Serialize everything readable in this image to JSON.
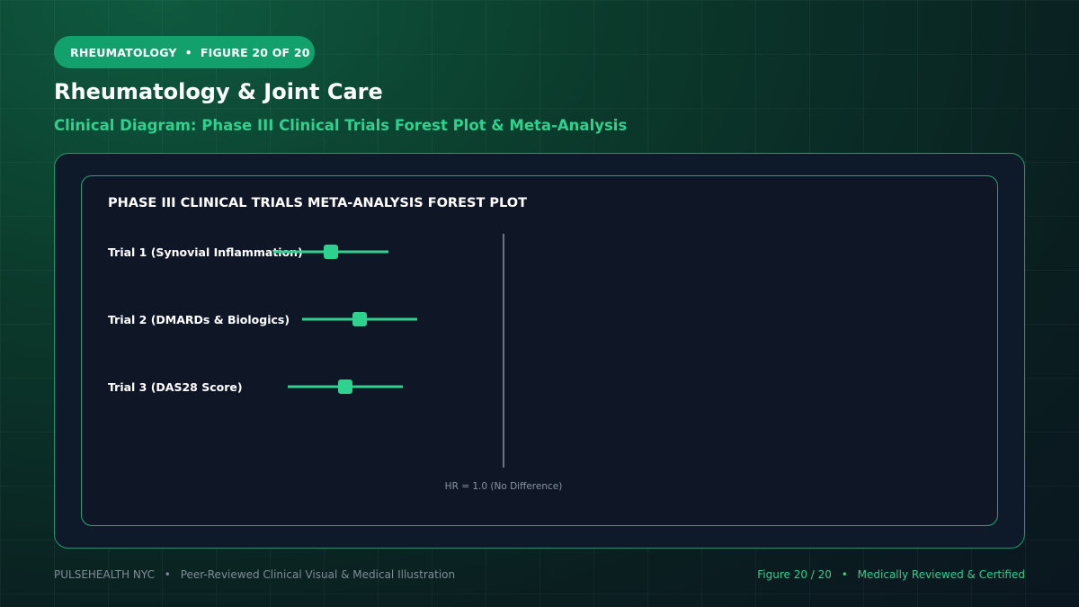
{
  "badge": {
    "category": "RHEUMATOLOGY",
    "separator": "•",
    "figure": "FIGURE 20 OF 20"
  },
  "header": {
    "title": "Rheumatology & Joint Care",
    "subtitle": "Clinical Diagram: Phase III Clinical Trials Forest Plot & Meta-Analysis"
  },
  "footer": {
    "brand": "PULSEHEALTH NYC",
    "separator": "•",
    "tagline": "Peer-Reviewed Clinical Visual & Medical Illustration",
    "figure": "Figure 20 / 20",
    "certification": "Medically Reviewed & Certified"
  },
  "colors": {
    "accent": "#2fd18f",
    "badge": "#12a16c",
    "reference_line": "#8a93a0",
    "card_border": "#22a675"
  },
  "chart_data": {
    "type": "forest",
    "title": "PHASE III CLINICAL TRIALS META-ANALYSIS FOREST PLOT",
    "reference_value": 1.0,
    "reference_label": "HR = 1.0 (No Difference)",
    "x_range": [
      0.0,
      1.5
    ],
    "trials": [
      {
        "label": "Trial 1 (Synovial Inflammation)",
        "estimate": 0.4,
        "ci_low": 0.2,
        "ci_high": 0.6
      },
      {
        "label": "Trial 2 (DMARDs & Biologics)",
        "estimate": 0.5,
        "ci_low": 0.3,
        "ci_high": 0.7
      },
      {
        "label": "Trial 3 (DAS28 Score)",
        "estimate": 0.45,
        "ci_low": 0.25,
        "ci_high": 0.65
      }
    ]
  }
}
